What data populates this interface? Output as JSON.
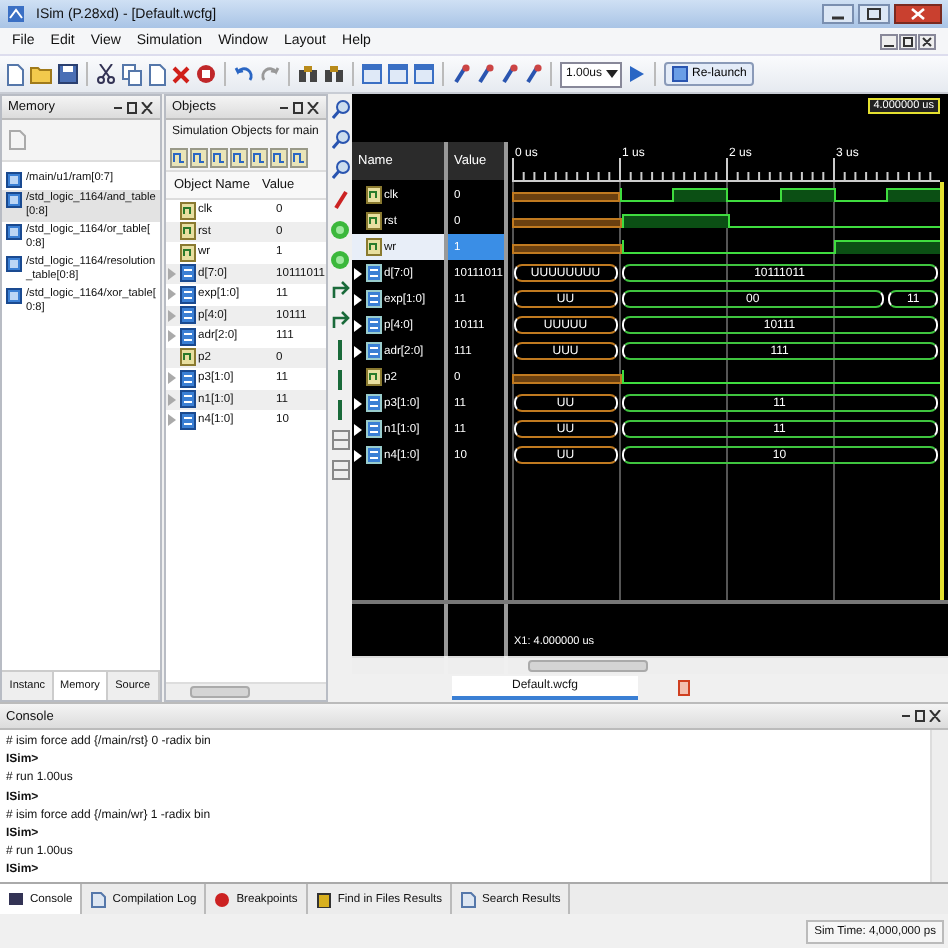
{
  "window": {
    "title": "ISim (P.28xd) - [Default.wcfg]"
  },
  "menu": [
    "File",
    "Edit",
    "View",
    "Simulation",
    "Window",
    "Layout",
    "Help"
  ],
  "toolbar": {
    "run_time": "1.00us",
    "relaunch": "Re-launch"
  },
  "memory_panel": {
    "title": "Memory",
    "items": [
      {
        "label": "/main/u1/ram[0:7]",
        "selected": false
      },
      {
        "label": "/std_logic_1164/and_table[0:8]",
        "selected": true
      },
      {
        "label": "/std_logic_1164/or_table[0:8]",
        "selected": false
      },
      {
        "label": "/std_logic_1164/resolution_table[0:8]",
        "selected": false
      },
      {
        "label": "/std_logic_1164/xor_table[0:8]",
        "selected": false
      }
    ],
    "tabs": [
      {
        "label": "Instanc",
        "selected": false
      },
      {
        "label": "Memory",
        "selected": true
      },
      {
        "label": "Source",
        "selected": false
      }
    ]
  },
  "objects_panel": {
    "title": "Objects",
    "subtitle": "Simulation Objects for main",
    "columns": [
      "Object Name",
      "Value"
    ],
    "rows": [
      {
        "name": "clk",
        "value": "0",
        "kind": "bit"
      },
      {
        "name": "rst",
        "value": "0",
        "kind": "bit"
      },
      {
        "name": "wr",
        "value": "1",
        "kind": "bit"
      },
      {
        "name": "d[7:0]",
        "value": "10111011",
        "kind": "bus"
      },
      {
        "name": "exp[1:0]",
        "value": "11",
        "kind": "bus"
      },
      {
        "name": "p[4:0]",
        "value": "10111",
        "kind": "bus"
      },
      {
        "name": "adr[2:0]",
        "value": "111",
        "kind": "bus"
      },
      {
        "name": "p2",
        "value": "0",
        "kind": "bit"
      },
      {
        "name": "p3[1:0]",
        "value": "11",
        "kind": "bus"
      },
      {
        "name": "n1[1:0]",
        "value": "11",
        "kind": "bus"
      },
      {
        "name": "n4[1:0]",
        "value": "10",
        "kind": "bus"
      }
    ]
  },
  "wave_window": {
    "cursor": "4.000000 us",
    "columns": [
      "Name",
      "Value"
    ],
    "ticks": [
      "0 us",
      "1 us",
      "2 us",
      "3 us"
    ],
    "signals": [
      {
        "name": "clk",
        "value": "0",
        "kind": "bit",
        "selected": false,
        "slots": [
          {
            "unknown": true
          },
          {
            "unknown": true
          },
          {
            "unknown": false,
            "high": false
          },
          {
            "unknown": false,
            "high": true
          },
          {
            "unknown": false,
            "high": false
          },
          {
            "unknown": false,
            "high": true
          },
          {
            "unknown": false,
            "high": false
          },
          {
            "unknown": false,
            "high": true
          }
        ]
      },
      {
        "name": "rst",
        "value": "0",
        "kind": "bit",
        "selected": false,
        "slots": [
          {
            "unknown": true
          },
          {
            "unknown": true
          },
          {
            "unknown": false,
            "high": true
          },
          {
            "unknown": false,
            "high": true
          },
          {
            "unknown": false,
            "high": false
          },
          {
            "unknown": false,
            "high": false
          },
          {
            "unknown": false,
            "high": false
          },
          {
            "unknown": false,
            "high": false
          }
        ]
      },
      {
        "name": "wr",
        "value": "1",
        "kind": "bit",
        "selected": true,
        "slots": [
          {
            "unknown": true
          },
          {
            "unknown": true
          },
          {
            "unknown": false,
            "high": false
          },
          {
            "unknown": false,
            "high": false
          },
          {
            "unknown": false,
            "high": false
          },
          {
            "unknown": false,
            "high": false
          },
          {
            "unknown": false,
            "high": true
          },
          {
            "unknown": false,
            "high": true
          }
        ]
      },
      {
        "name": "d[7:0]",
        "value": "10111011",
        "kind": "bus",
        "selected": false,
        "values": [
          "UUUUUUUU",
          "10111011"
        ],
        "slots": [
          {
            "unknown": true,
            "change": true
          },
          {
            "unknown": true,
            "change": false
          },
          {
            "unknown": false,
            "change": true
          },
          {
            "unknown": false,
            "change": false
          },
          {
            "unknown": false,
            "change": false
          },
          {
            "unknown": false,
            "change": false
          },
          {
            "unknown": false,
            "change": false
          },
          {
            "unknown": false,
            "change": false
          }
        ]
      },
      {
        "name": "exp[1:0]",
        "value": "11",
        "kind": "bus",
        "selected": false,
        "values": [
          "UU",
          "00",
          "11"
        ],
        "slots": [
          {
            "unknown": true,
            "change": true
          },
          {
            "unknown": true,
            "change": false
          },
          {
            "unknown": false,
            "change": true
          },
          {
            "unknown": false,
            "change": false
          },
          {
            "unknown": false,
            "change": false
          },
          {
            "unknown": false,
            "change": false
          },
          {
            "unknown": false,
            "change": false
          },
          {
            "unknown": false,
            "change": true
          }
        ]
      },
      {
        "name": "p[4:0]",
        "value": "10111",
        "kind": "bus",
        "selected": false,
        "values": [
          "UUUUU",
          "10111"
        ],
        "slots": [
          {
            "unknown": true,
            "change": true
          },
          {
            "unknown": true,
            "change": false
          },
          {
            "unknown": false,
            "change": true
          },
          {
            "unknown": false,
            "change": false
          },
          {
            "unknown": false,
            "change": false
          },
          {
            "unknown": false,
            "change": false
          },
          {
            "unknown": false,
            "change": false
          },
          {
            "unknown": false,
            "change": false
          }
        ]
      },
      {
        "name": "adr[2:0]",
        "value": "111",
        "kind": "bus",
        "selected": false,
        "values": [
          "UUU",
          "111"
        ],
        "slots": [
          {
            "unknown": true,
            "change": true
          },
          {
            "unknown": true,
            "change": false
          },
          {
            "unknown": false,
            "change": true
          },
          {
            "unknown": false,
            "change": false
          },
          {
            "unknown": false,
            "change": false
          },
          {
            "unknown": false,
            "change": false
          },
          {
            "unknown": false,
            "change": false
          },
          {
            "unknown": false,
            "change": false
          }
        ]
      },
      {
        "name": "p2",
        "value": "0",
        "kind": "bit",
        "selected": false,
        "slots": [
          {
            "unknown": true
          },
          {
            "unknown": true
          },
          {
            "unknown": false,
            "high": false
          },
          {
            "unknown": false,
            "high": false
          },
          {
            "unknown": false,
            "high": false
          },
          {
            "unknown": false,
            "high": false
          },
          {
            "unknown": false,
            "high": false
          },
          {
            "unknown": false,
            "high": false
          }
        ]
      },
      {
        "name": "p3[1:0]",
        "value": "11",
        "kind": "bus",
        "selected": false,
        "values": [
          "UU",
          "11"
        ],
        "slots": [
          {
            "unknown": true,
            "change": true
          },
          {
            "unknown": true,
            "change": false
          },
          {
            "unknown": false,
            "change": true
          },
          {
            "unknown": false,
            "change": false
          },
          {
            "unknown": false,
            "change": false
          },
          {
            "unknown": false,
            "change": false
          },
          {
            "unknown": false,
            "change": false
          },
          {
            "unknown": false,
            "change": false
          }
        ]
      },
      {
        "name": "n1[1:0]",
        "value": "11",
        "kind": "bus",
        "selected": false,
        "values": [
          "UU",
          "11"
        ],
        "slots": [
          {
            "unknown": true,
            "change": true
          },
          {
            "unknown": true,
            "change": false
          },
          {
            "unknown": false,
            "change": true
          },
          {
            "unknown": false,
            "change": false
          },
          {
            "unknown": false,
            "change": false
          },
          {
            "unknown": false,
            "change": false
          },
          {
            "unknown": false,
            "change": false
          },
          {
            "unknown": false,
            "change": false
          }
        ]
      },
      {
        "name": "n4[1:0]",
        "value": "10",
        "kind": "bus",
        "selected": false,
        "values": [
          "UU",
          "10"
        ],
        "slots": [
          {
            "unknown": true,
            "change": true
          },
          {
            "unknown": true,
            "change": false
          },
          {
            "unknown": false,
            "change": true
          },
          {
            "unknown": false,
            "change": false
          },
          {
            "unknown": false,
            "change": false
          },
          {
            "unknown": false,
            "change": false
          },
          {
            "unknown": false,
            "change": false
          },
          {
            "unknown": false,
            "change": false
          }
        ]
      }
    ],
    "cursor_readout": "X1: 4.000000 us",
    "tab": "Default.wcfg"
  },
  "console": {
    "title": "Console",
    "lines": [
      {
        "text": "# isim force add {/main/rst} 0 -radix bin",
        "kind": "command"
      },
      {
        "text": "ISim>",
        "kind": "prompt"
      },
      {
        "text": "# run 1.00us",
        "kind": "command"
      },
      {
        "text": "ISim>",
        "kind": "prompt"
      },
      {
        "text": "# isim force add {/main/wr} 1 -radix bin",
        "kind": "command"
      },
      {
        "text": "ISim>",
        "kind": "prompt"
      },
      {
        "text": "# run 1.00us",
        "kind": "command"
      },
      {
        "text": "ISim>",
        "kind": "prompt"
      }
    ],
    "tabs": [
      {
        "label": "Console",
        "selected": true
      },
      {
        "label": "Compilation Log",
        "selected": false
      },
      {
        "label": "Breakpoints",
        "selected": false
      },
      {
        "label": "Find in Files Results",
        "selected": false
      },
      {
        "label": "Search Results",
        "selected": false
      }
    ]
  },
  "status_bar": {
    "sim_time": "Sim Time: 4,000,000 ps"
  }
}
